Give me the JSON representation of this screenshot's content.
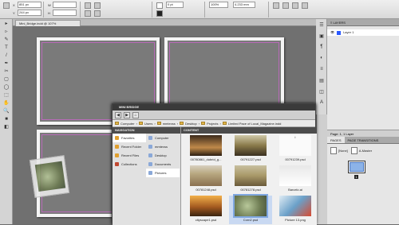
{
  "control_bar": {
    "x_value": "851 px",
    "y_value": "244 px",
    "w_value": "",
    "h_value": "",
    "stroke_value": "0 pt",
    "percent": "100%",
    "spacing": "4.233 mm"
  },
  "document": {
    "tab_title": "Mini_Bridge.indd @ 107%"
  },
  "tools": [
    "▸",
    "▹",
    "✎",
    "T",
    "/",
    "✒",
    "✂",
    "▢",
    "◯",
    "⬚",
    "✋",
    "🔍",
    "■",
    "◧"
  ],
  "panel_icons": [
    "☰",
    "▣",
    "¶",
    "◐",
    "≡",
    "▤",
    "◫",
    "A"
  ],
  "layers_panel": {
    "tab_label": "≡ LAYERS",
    "rows": [
      {
        "label": "Layer 1"
      }
    ],
    "footer": "Page: 1, 1 Layer"
  },
  "pages_panel": {
    "tabs": [
      "PAGES",
      "PAGE TRANSITIONS"
    ],
    "masters": [
      "[None]",
      "A-Master"
    ],
    "page_number": "1"
  },
  "mini_bridge": {
    "title": "MINI BRIDGE",
    "toolbar_icons": [
      "◀",
      "▶",
      "⌂"
    ],
    "path": [
      "Computer",
      "Users",
      "mmtexss",
      "Desktop",
      "Projects",
      "Limited Pace of Local_Magazine.indd"
    ],
    "navigation_header": "NAVIGATION",
    "content_header": "CONTENT",
    "nav_left": [
      {
        "label": "Favorites",
        "color": "#e0a030"
      },
      {
        "label": "Recent Folder",
        "color": "#e0a030"
      },
      {
        "label": "Recent Files",
        "color": "#e0a030"
      },
      {
        "label": "Collections",
        "color": "#c04830"
      }
    ],
    "nav_right": [
      {
        "label": "Computer"
      },
      {
        "label": "mmtexss"
      },
      {
        "label": "Desktop"
      },
      {
        "label": "Documents"
      },
      {
        "label": "Pictures"
      }
    ],
    "files": [
      {
        "name": "00780861_dubrid_g...",
        "selected": false
      },
      {
        "name": "00791227.psd",
        "selected": false
      },
      {
        "name": "00791239.psd",
        "selected": false
      },
      {
        "name": "00781248.psd",
        "selected": false
      },
      {
        "name": "00781278.psd",
        "selected": false
      },
      {
        "name": "Barcelo.ai",
        "selected": false
      },
      {
        "name": "cityscape1.psd",
        "selected": false
      },
      {
        "name": "Corn2.psd",
        "selected": true
      },
      {
        "name": "Picture 13.png",
        "selected": false
      }
    ]
  }
}
